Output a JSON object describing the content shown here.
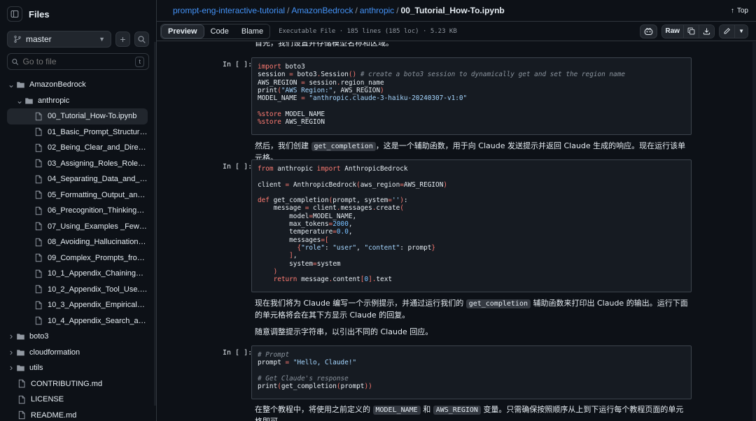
{
  "sidebar": {
    "title": "Files",
    "branch": "master",
    "goto_placeholder": "Go to file",
    "goto_shortcut": "t",
    "tree": [
      {
        "label": "AmazonBedrock",
        "type": "folder",
        "open": true,
        "depth": 0
      },
      {
        "label": "anthropic",
        "type": "folder",
        "open": true,
        "depth": 1
      },
      {
        "label": "00_Tutorial_How-To.ipynb",
        "type": "file",
        "depth": 2,
        "active": true
      },
      {
        "label": "01_Basic_Prompt_Structure.ipy...",
        "type": "file",
        "depth": 2
      },
      {
        "label": "02_Being_Clear_and_Direct.ipy...",
        "type": "file",
        "depth": 2
      },
      {
        "label": "03_Assigning_Roles_Role_Pro...",
        "type": "file",
        "depth": 2
      },
      {
        "label": "04_Separating_Data_and_Instr...",
        "type": "file",
        "depth": 2
      },
      {
        "label": "05_Formatting_Output_and_S...",
        "type": "file",
        "depth": 2
      },
      {
        "label": "06_Precognition_Thinking_Ste...",
        "type": "file",
        "depth": 2
      },
      {
        "label": "07_Using_Examples _Few-Shot...",
        "type": "file",
        "depth": 2
      },
      {
        "label": "08_Avoiding_Hallucinations.ipy...",
        "type": "file",
        "depth": 2
      },
      {
        "label": "09_Complex_Prompts_from_S...",
        "type": "file",
        "depth": 2
      },
      {
        "label": "10_1_Appendix_Chaining_Prom...",
        "type": "file",
        "depth": 2
      },
      {
        "label": "10_2_Appendix_Tool_Use.ipynb",
        "type": "file",
        "depth": 2
      },
      {
        "label": "10_3_Appendix_Empirical_Perf...",
        "type": "file",
        "depth": 2
      },
      {
        "label": "10_4_Appendix_Search_and_R...",
        "type": "file",
        "depth": 2
      },
      {
        "label": "boto3",
        "type": "folder",
        "open": false,
        "depth": 0
      },
      {
        "label": "cloudformation",
        "type": "folder",
        "open": false,
        "depth": 0
      },
      {
        "label": "utils",
        "type": "folder",
        "open": false,
        "depth": 0
      },
      {
        "label": "CONTRIBUTING.md",
        "type": "file",
        "depth": 0
      },
      {
        "label": "LICENSE",
        "type": "file",
        "depth": 0
      },
      {
        "label": "README.md",
        "type": "file",
        "depth": 0
      }
    ]
  },
  "breadcrumb": {
    "repo": "prompt-eng-interactive-tutorial",
    "folder1": "AmazonBedrock",
    "folder2": "anthropic",
    "file": "00_Tutorial_How-To.ipynb",
    "top_label": "Top"
  },
  "toolbar": {
    "tab_preview": "Preview",
    "tab_code": "Code",
    "tab_blame": "Blame",
    "meta": "Executable File · 185 lines (185 loc) · 5.23 KB",
    "raw_label": "Raw"
  },
  "notebook": {
    "text0": "首先，我们设置并存储模型名称和区域。",
    "prompt_label": "In [ ]:",
    "text1_pre": "然后，我们创建",
    "text1_code": "get_completion",
    "text1_post": "，这是一个辅助函数，用于向 Claude 发送提示并返回 Claude 生成的响应。现在运行该单元格。",
    "text2_pre": "现在我们将为 Claude 编写一个示例提示，并通过运行我们的",
    "text2_code": "get_completion",
    "text2_post": "辅助函数来打印出 Claude 的输出。运行下面的单元格将会在其下方显示 Claude 的回复。",
    "text3": "随意调整提示字符串，以引出不同的 Claude 回应。",
    "text4_pre": "在整个教程中，将使用之前定义的",
    "text4_code1": "MODEL_NAME",
    "text4_mid": "和",
    "text4_code2": "AWS_REGION",
    "text4_post": "变量。只需确保按照顺序从上到下运行每个教程页面的单元格即可。",
    "cell1": [
      "import boto3",
      "session = boto3.Session() # create a boto3 session to dynamically get and set the region name",
      "AWS_REGION = session.region_name",
      "print(\"AWS Region:\", AWS_REGION)",
      "MODEL_NAME = \"anthropic.claude-3-haiku-20240307-v1:0\"",
      "",
      "%store MODEL_NAME",
      "%store AWS_REGION"
    ],
    "cell2": [
      "from anthropic import AnthropicBedrock",
      "",
      "client = AnthropicBedrock(aws_region=AWS_REGION)",
      "",
      "def get_completion(prompt, system=''):",
      "    message = client.messages.create(",
      "        model=MODEL_NAME,",
      "        max_tokens=2000,",
      "        temperature=0.0,",
      "        messages=[",
      "          {\"role\": \"user\", \"content\": prompt}",
      "        ],",
      "        system=system",
      "    )",
      "    return message.content[0].text"
    ],
    "cell3": [
      "# Prompt",
      "prompt = \"Hello, Claude!\"",
      "",
      "# Get Claude's response",
      "print(get_completion(prompt))"
    ]
  },
  "colors": {
    "background": "#0d1117",
    "link": "#4493f8",
    "keyword": "#ff7b72",
    "string": "#a5d6ff",
    "comment": "#8b949e"
  }
}
